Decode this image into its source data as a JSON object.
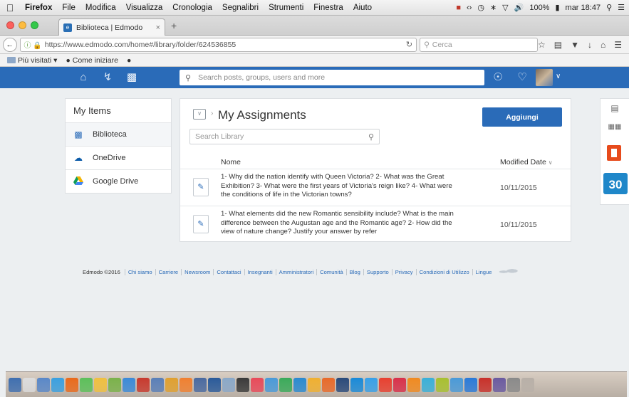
{
  "mac_menubar": {
    "app_name": "Firefox",
    "menus": [
      "File",
      "Modifica",
      "Visualizza",
      "Cronologia",
      "Segnalibri",
      "Strumenti",
      "Finestra",
      "Aiuto"
    ],
    "battery": "100%",
    "clock": "mar 18:47"
  },
  "browser": {
    "tab_title": "Biblioteca | Edmodo",
    "url": "https://www.edmodo.com/home#/library/folder/624536855",
    "url_domain": "edmodo.com",
    "search_placeholder": "Cerca",
    "bookmarks": [
      "Più visitati",
      "Come iniziare"
    ]
  },
  "edmodo_header": {
    "search_placeholder": "Search posts, groups, users and more",
    "icons": [
      "home-icon",
      "pulse-icon",
      "library-icon",
      "backpack-icon",
      "bell-icon"
    ]
  },
  "left_panel": {
    "title": "My Items",
    "items": [
      {
        "label": "Biblioteca",
        "icon": "library-book-icon",
        "color": "#2a6bb8",
        "active": true
      },
      {
        "label": "OneDrive",
        "icon": "onedrive-cloud-icon",
        "color": "#0a5aa8",
        "active": false
      },
      {
        "label": "Google Drive",
        "icon": "google-drive-icon",
        "color": "#f4b400",
        "active": false
      }
    ]
  },
  "main_panel": {
    "title": "My Assignments",
    "add_button": "Aggiungi",
    "search_placeholder": "Search Library",
    "columns": {
      "name": "Nome",
      "date": "Modified Date"
    },
    "rows": [
      {
        "text": "1- Why did the nation identify with Queen Victoria? 2- What was the Great Exhibition? 3- What were the first years of Victoria's reign like? 4- What were the conditions of life in the Victorian towns?",
        "date": "10/11/2015"
      },
      {
        "text": "1- What elements did the new Romantic sensibility include? What is the main difference between the Augustan age and the Romantic age? 2- How did the view of nature change? Justify your answer by refer",
        "date": "10/11/2015"
      }
    ]
  },
  "footer": {
    "copyright": "Edmodo ©2016",
    "links": [
      "Chi siamo",
      "Carriere",
      "Newsroom",
      "Contattaci",
      "Insegnanti",
      "Amministratori",
      "Comunità",
      "Blog",
      "Supporto",
      "Privacy",
      "Condizioni di Utilizzo",
      "Lingue"
    ]
  },
  "right_rail": {
    "calendar_day": "30"
  },
  "colors": {
    "edmodo_blue": "#2a6bb8",
    "office_orange": "#e74b1c",
    "calendar_blue": "#1f87c9"
  },
  "dock_colors": [
    "#3f6fb0",
    "#dcdcdc",
    "#5a88c8",
    "#3aa0e0",
    "#e96a1c",
    "#5cc05a",
    "#f0c040",
    "#7ab24a",
    "#3b8ad8",
    "#c73a2e",
    "#5a7fb8",
    "#e0a030",
    "#f08030",
    "#4a6aa0",
    "#2a5a9a",
    "#8aa8c8",
    "#3a3a3a",
    "#e84a5a",
    "#4a9ad8",
    "#3aaa5a",
    "#2a8ad0",
    "#f0b030",
    "#e86a2a",
    "#2a4a7a",
    "#1a8ad8",
    "#38a0e8",
    "#e84030",
    "#d8304a",
    "#f08a20",
    "#3ab0d8",
    "#a8c030",
    "#4a9ad8",
    "#2a7ad8",
    "#c8302a",
    "#6a5aa0",
    "#8a8a8a",
    "#b8b0a8"
  ]
}
